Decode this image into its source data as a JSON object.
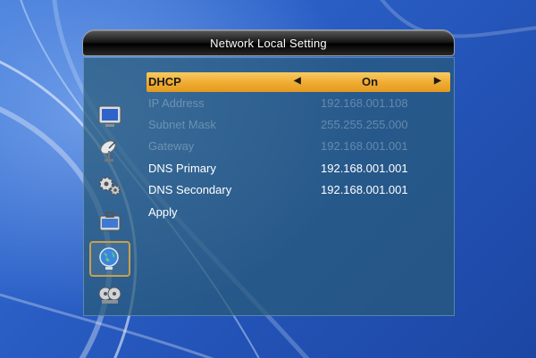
{
  "window": {
    "title": "Network Local Setting"
  },
  "sidebar": {
    "items": [
      {
        "icon": "tv-icon"
      },
      {
        "icon": "satellite-dish-icon"
      },
      {
        "icon": "gears-icon"
      },
      {
        "icon": "toolbox-icon"
      },
      {
        "icon": "globe-network-icon",
        "selected": true
      },
      {
        "icon": "film-reel-icon"
      }
    ]
  },
  "settings": {
    "dhcp": {
      "label": "DHCP",
      "value": "On"
    },
    "ip_address": {
      "label": "IP Address",
      "value": "192.168.001.108"
    },
    "subnet_mask": {
      "label": "Subnet Mask",
      "value": "255.255.255.000"
    },
    "gateway": {
      "label": "Gateway",
      "value": "192.168.001.001"
    },
    "dns_primary": {
      "label": "DNS Primary",
      "value": "192.168.001.001"
    },
    "dns_secondary": {
      "label": "DNS Secondary",
      "value": "192.168.001.001"
    },
    "apply": {
      "label": "Apply"
    }
  },
  "colors": {
    "highlight": "#f0ad34",
    "panel": "#285a78",
    "background": "#2a5fc6"
  }
}
